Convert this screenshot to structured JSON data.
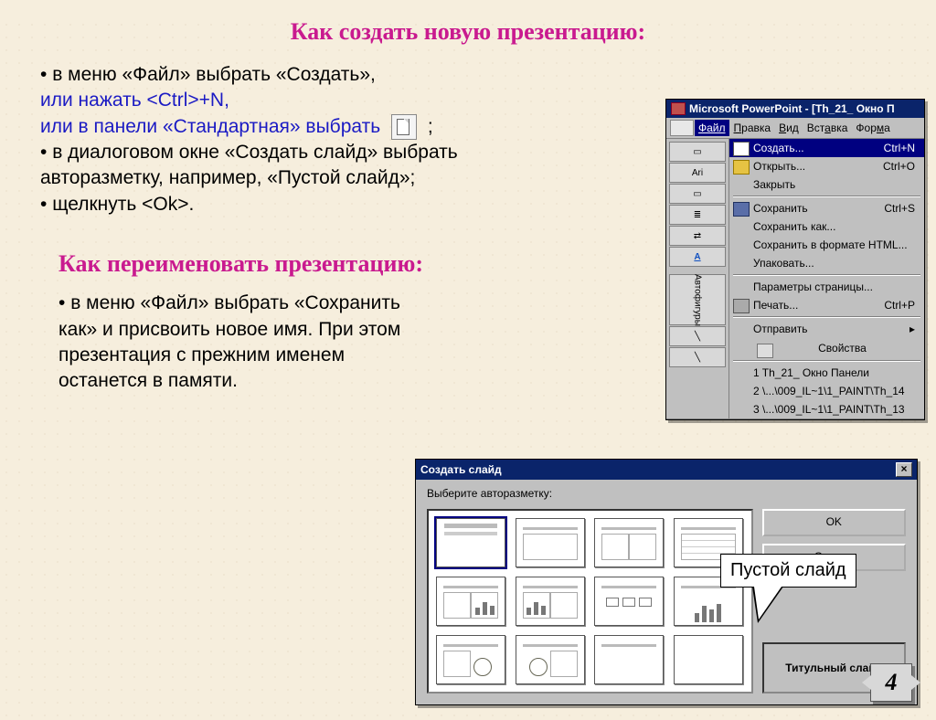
{
  "heading1": "Как создать новую презентацию:",
  "heading2": "Как переименовать презентацию:",
  "para1": {
    "l1": "в меню «Файл» выбрать «Создать»,",
    "l2": "или нажать <Ctrl>+N,",
    "l3a": "или  в панели «Стандартная» выбрать",
    "l3b": ";",
    "l4": "в диалоговом окне «Создать слайд» выбрать авторазметку, например, «Пустой слайд»;",
    "l5": "щелкнуть <Ok>."
  },
  "para2": "в меню «Файл» выбрать «Сохранить как» и присвоить новое имя. При этом презентация с прежним именем останется в памяти.",
  "ppwin": {
    "title": "Microsoft PowerPoint - [Th_21_ Окно П",
    "menubar": [
      "Файл",
      "Правка",
      "Вид",
      "Вставка",
      "Форма"
    ],
    "font": "Ari",
    "items": [
      {
        "label": "Создать...",
        "short": "Ctrl+N",
        "ico": "new",
        "hl": true
      },
      {
        "label": "Открыть...",
        "short": "Ctrl+O",
        "ico": "open"
      },
      {
        "label": "Закрыть",
        "short": ""
      },
      {
        "sep": true
      },
      {
        "label": "Сохранить",
        "short": "Ctrl+S",
        "ico": "save"
      },
      {
        "label": "Сохранить как...",
        "short": ""
      },
      {
        "label": "Сохранить в формате HTML...",
        "short": ""
      },
      {
        "label": "Упаковать...",
        "short": ""
      },
      {
        "sep": true
      },
      {
        "label": "Параметры страницы...",
        "short": ""
      },
      {
        "label": "Печать...",
        "short": "Ctrl+P",
        "ico": "print"
      },
      {
        "sep": true
      },
      {
        "label": "Отправить",
        "short": "",
        "arrow": true
      },
      {
        "label": "Свойства",
        "short": "",
        "ico": "props"
      },
      {
        "sep": true
      },
      {
        "label": "1 Th_21_ Окно Панели",
        "short": ""
      },
      {
        "label": "2 \\...\\009_IL~1\\1_PAINT\\Th_14",
        "short": ""
      },
      {
        "label": "3 \\...\\009_IL~1\\1_PAINT\\Th_13",
        "short": ""
      }
    ]
  },
  "dialog": {
    "title": "Создать слайд",
    "prompt": "Выберите авторазметку:",
    "ok": "OK",
    "cancel": "Отмена",
    "preview": "Титульный слайд"
  },
  "callout": "Пустой слайд",
  "page": "4"
}
